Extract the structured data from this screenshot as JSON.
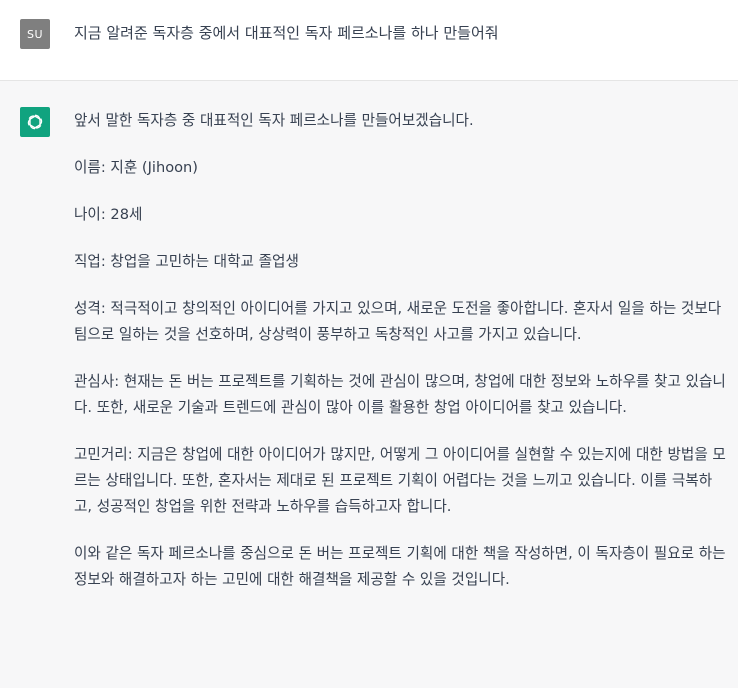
{
  "user_message": {
    "avatar_initials": "SU",
    "text": "지금 알려준 독자층 중에서 대표적인 독자 페르소나를 하나 만들어줘"
  },
  "assistant_message": {
    "avatar_icon": "openai-logo-icon",
    "paragraphs": [
      "앞서 말한 독자층 중 대표적인 독자 페르소나를 만들어보겠습니다.",
      "이름: 지훈 (Jihoon)",
      "나이: 28세",
      "직업: 창업을 고민하는 대학교 졸업생",
      "성격: 적극적이고 창의적인 아이디어를 가지고 있으며, 새로운 도전을 좋아합니다. 혼자서 일을 하는 것보다 팀으로 일하는 것을 선호하며, 상상력이 풍부하고 독창적인 사고를 가지고 있습니다.",
      "관심사: 현재는 돈 버는 프로젝트를 기획하는 것에 관심이 많으며, 창업에 대한 정보와 노하우를 찾고 있습니다. 또한, 새로운 기술과 트렌드에 관심이 많아 이를 활용한 창업 아이디어를 찾고 있습니다.",
      "고민거리: 지금은 창업에 대한 아이디어가 많지만, 어떻게 그 아이디어를 실현할 수 있는지에 대한 방법을 모르는 상태입니다. 또한, 혼자서는 제대로 된 프로젝트 기획이 어렵다는 것을 느끼고 있습니다. 이를 극복하고, 성공적인 창업을 위한 전략과 노하우를 습득하고자 합니다.",
      "이와 같은 독자 페르소나를 중심으로 돈 버는 프로젝트 기획에 대한 책을 작성하면, 이 독자층이 필요로 하는 정보와 해결하고자 하는 고민에 대한 해결책을 제공할 수 있을 것입니다."
    ]
  },
  "colors": {
    "user_avatar": "#7f7f7f",
    "assistant_avatar": "#10a37f",
    "assistant_bg": "#f7f7f8",
    "text": "#374151"
  }
}
